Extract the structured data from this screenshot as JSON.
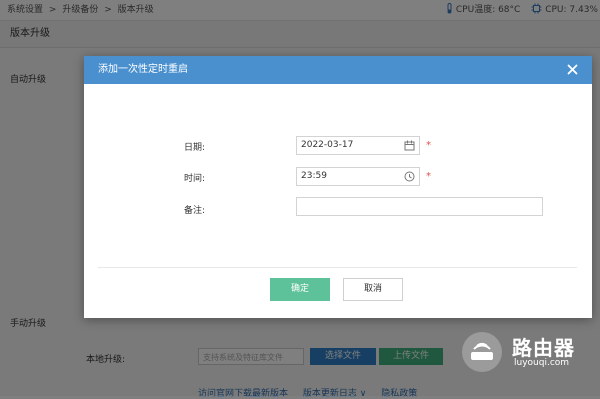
{
  "breadcrumb": [
    "系统设置",
    ">",
    "升级备份",
    ">",
    "版本升级"
  ],
  "status": {
    "cpu_temp": "CPU温度: 68°C",
    "cpu_usage": "CPU: 7.43%"
  },
  "page": {
    "header": "版本升级",
    "auto_upgrade_label": "自动升级",
    "manual_upgrade_label": "手动升级",
    "local_upgrade_label": "本地升级:",
    "file_placeholder": "支持系统及特征库文件",
    "select_file_button": "选择文件",
    "upload_file_button": "上传文件",
    "links": [
      "访问官网下载最新版本",
      "版本更新日志 ∨",
      "隐私政策"
    ]
  },
  "modal": {
    "title": "添加一次性定时重启",
    "date_label": "日期:",
    "date_value": "2022-03-17",
    "time_label": "时间:",
    "time_value": "23:59",
    "note_label": "备注:",
    "note_value": "",
    "required_mark": "*",
    "ok_button": "确定",
    "cancel_button": "取消"
  },
  "watermark": {
    "text": "路由器",
    "url": "luyouqi.com"
  },
  "colors": {
    "modal_header": "#4a90cf",
    "ok_button": "#5dc19a",
    "select_button": "#2f7ec6",
    "upload_button": "#3fb07c",
    "required": "#e0534a"
  },
  "icons": {
    "cpu_temp": "thermometer-icon",
    "cpu_usage": "cpu-chip-icon",
    "date_field": "calendar-icon",
    "time_field": "clock-icon",
    "close": "close-icon",
    "watermark": "router-logo-icon"
  }
}
